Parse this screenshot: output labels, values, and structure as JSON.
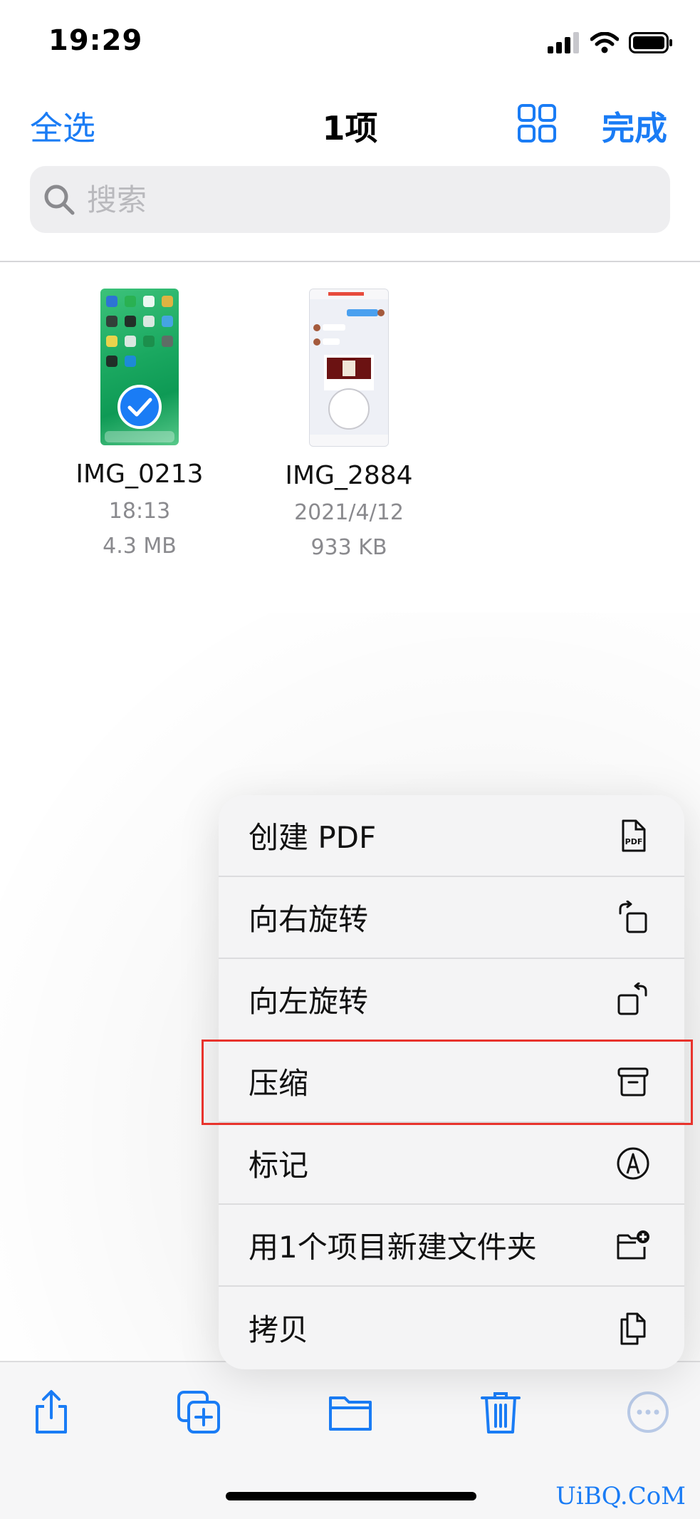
{
  "status_bar": {
    "time": "19:29"
  },
  "nav": {
    "select_all": "全选",
    "title": "1项",
    "done": "完成"
  },
  "search": {
    "placeholder": "搜索",
    "value": ""
  },
  "files": [
    {
      "name": "IMG_0213",
      "date": "18:13",
      "size": "4.3 MB",
      "selected": true
    },
    {
      "name": "IMG_2884",
      "date": "2021/4/12",
      "size": "933 KB",
      "selected": false
    }
  ],
  "menu": {
    "items": [
      {
        "label": "创建 PDF",
        "icon": "pdf-document-icon"
      },
      {
        "label": "向右旋转",
        "icon": "rotate-right-icon"
      },
      {
        "label": "向左旋转",
        "icon": "rotate-left-icon"
      },
      {
        "label": "压缩",
        "icon": "archive-box-icon"
      },
      {
        "label": "标记",
        "icon": "markup-pen-icon"
      },
      {
        "label": "用1个项目新建文件夹",
        "icon": "folder-plus-icon"
      },
      {
        "label": "拷贝",
        "icon": "copy-document-icon"
      }
    ],
    "highlighted_item": "压缩"
  },
  "toolbar": {
    "items": [
      "share-icon",
      "duplicate-icon",
      "folder-icon",
      "trash-icon",
      "more-icon"
    ]
  },
  "watermark": "UiBQ.CoM",
  "colors": {
    "accent": "#1a7cf5",
    "highlight_border": "#e8332c"
  }
}
